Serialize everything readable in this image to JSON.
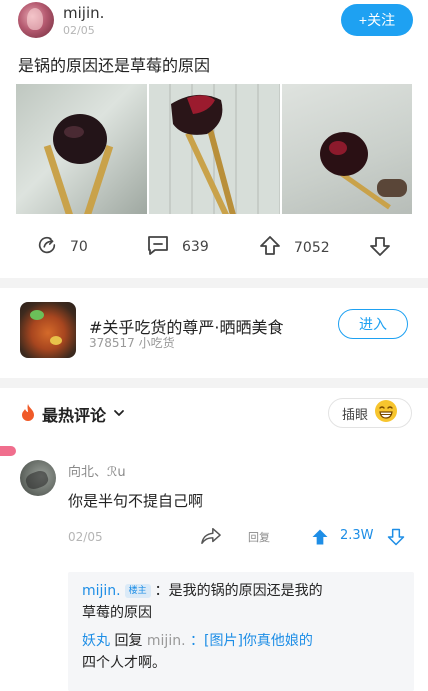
{
  "post": {
    "username": "mijin.",
    "date": "02/05",
    "follow_label": "+关注",
    "title": "是锅的原因还是草莓的原因",
    "stats": {
      "shares": "70",
      "comments": "639",
      "likes": "7052"
    }
  },
  "circle": {
    "name": "#关乎吃货的尊严·晒晒美食",
    "members": "378517 小吃货",
    "join_label": "进入"
  },
  "comments_section": {
    "sort_label": "最热评论",
    "cut_in_label": "插眼"
  },
  "comment": {
    "username": "向北、ℛu",
    "text": "你是半句不提自己啊",
    "date": "02/05",
    "reply_label": "回复",
    "like_count": "2.3W",
    "replies": [
      {
        "author": "mijin.",
        "badge": "楼主",
        "text_line1": "：是我的锅的原因还是我的",
        "text_line2": "草莓的原因"
      },
      {
        "author": "妖丸",
        "reply_word": "回复",
        "target": "mijin.",
        "text_line1": "：[图片]你真他娘的",
        "text_line2": "四个人才啊。"
      }
    ]
  },
  "colors": {
    "accent": "#1ea1f2",
    "link": "#1e8ee6",
    "hot": "#f05a28"
  }
}
